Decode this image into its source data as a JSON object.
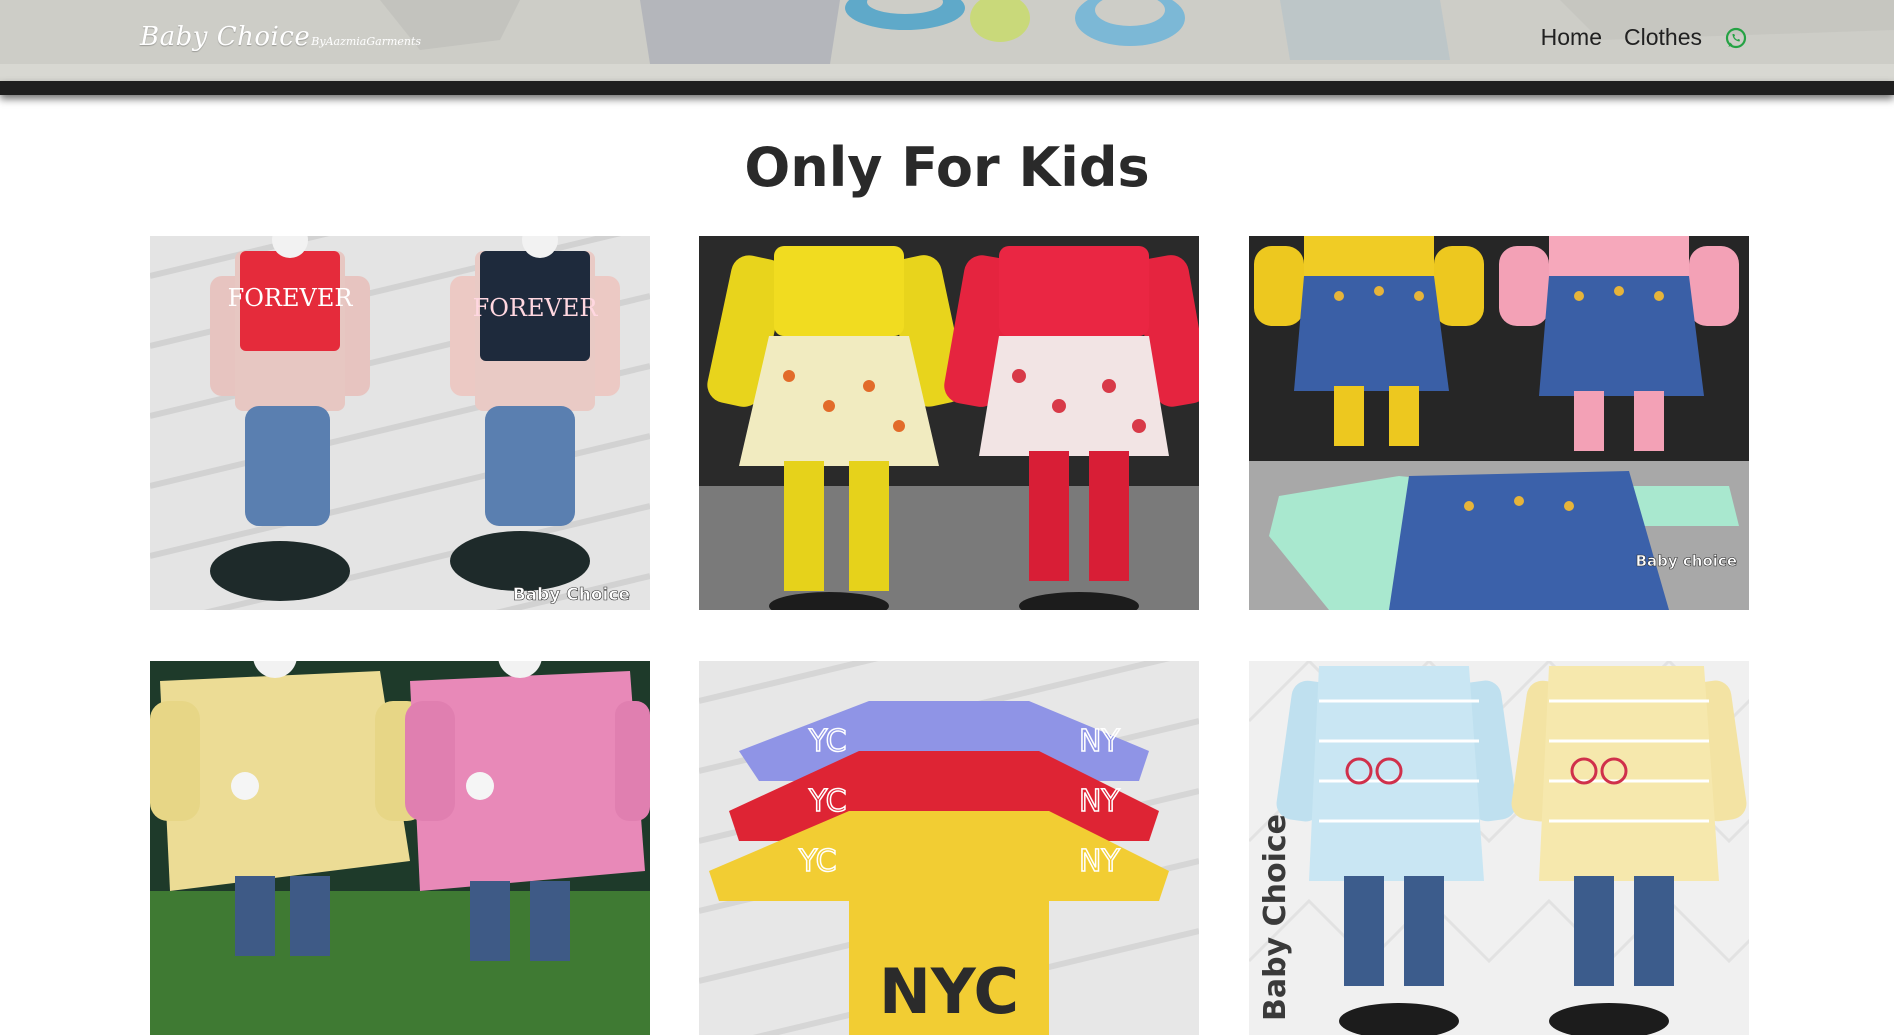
{
  "brand": {
    "name": "Baby Choice",
    "tagline": "ByAazmiaGarments"
  },
  "nav": {
    "home": "Home",
    "clothes": "Clothes",
    "whatsapp_icon": "whatsapp-icon"
  },
  "colors": {
    "nav_background": "#cecec8",
    "nav_bar": "#1f1f1f",
    "heading": "#2a2a2a",
    "whatsapp": "#25a244"
  },
  "heading": "Only For Kids",
  "products": [
    {
      "watermark": "Baby Choice"
    },
    {
      "watermark": ""
    },
    {
      "watermark": "Baby choice"
    },
    {
      "watermark": ""
    },
    {
      "watermark": ""
    },
    {
      "watermark": "Baby Choice"
    }
  ]
}
